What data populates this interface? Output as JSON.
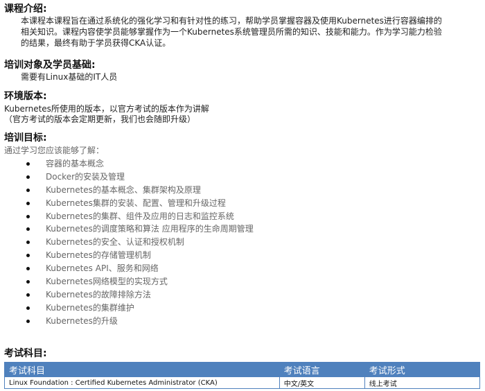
{
  "intro": {
    "heading": "课程介绍:",
    "line1": "本课程本课程旨在通过系统化的强化学习和有针对性的练习，帮助学员掌握容器及使用Kubernetes进行容器编排的",
    "line2": "相关知识。课程内容使学员能够掌握作为一个Kubernetes系统管理员所需的知识、技能和能力。作为学习能力检验",
    "line3": "的结果，最终有助于学员获得CKA认证。"
  },
  "audience": {
    "heading": "培训对象及学员基础:",
    "text": "需要有Linux基础的IT人员"
  },
  "env": {
    "heading": "环境版本:",
    "line1": "Kubernetes所使用的版本，以官方考试的版本作为讲解",
    "line2": "（官方考试的版本会定期更新，我们也会随即升级）"
  },
  "goals": {
    "heading": "培训目标:",
    "lead": "通过学习您应该能够了解：",
    "items": [
      "容器的基本概念",
      "Docker的安装及管理",
      "Kubernetes的基本概念、集群架构及原理",
      "Kubernetes集群的安装、配置、管理和升级过程",
      "Kubernetes的集群、组件及应用的日志和监控系统",
      "Kubernetes的调度策略和算法 应用程序的生命周期管理",
      "Kubernetes的安全、认证和授权机制",
      "Kubernetes的存储管理机制",
      "Kubernetes API、服务和网络",
      "Kubernetes网络模型的实现方式",
      "Kubernetes的故障排除方法",
      "Kubernetes的集群维护",
      "Kubernetes的升级"
    ]
  },
  "exam": {
    "heading": "考试科目:",
    "columns": [
      "考试科目",
      "考试语言",
      "考试形式"
    ],
    "row": [
      "Linux Foundation : Certified Kubernetes Administrator (CKA)",
      "中文/英文",
      "线上考试"
    ],
    "colors": {
      "header_bg": "#4f81bd",
      "header_text": "#ffffff"
    }
  }
}
